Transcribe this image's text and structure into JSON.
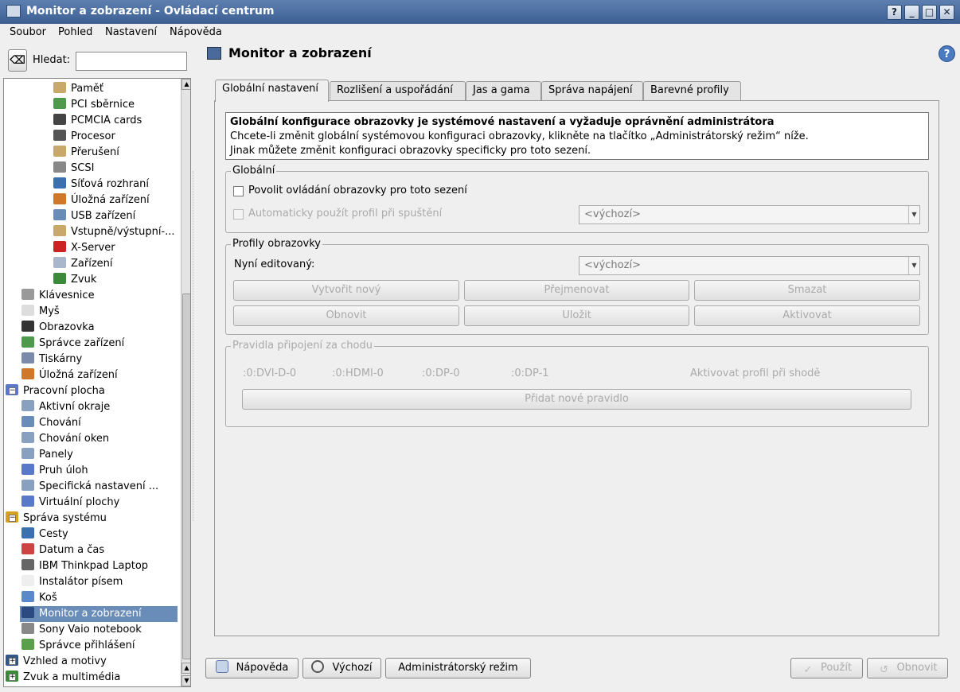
{
  "window": {
    "title": "Monitor a zobrazení - Ovládací centrum",
    "buttons": [
      "?",
      "_",
      "□",
      "✕"
    ]
  },
  "menubar": {
    "items": [
      "Soubor",
      "Pohled",
      "Nastavení",
      "Nápověda"
    ]
  },
  "search": {
    "label": "Hledat:",
    "value": ""
  },
  "tree": [
    {
      "label": "Paměť",
      "icon": "memory-icon"
    },
    {
      "label": "PCI sběrnice",
      "icon": "pci-icon"
    },
    {
      "label": "PCMCIA cards",
      "icon": "pcmcia-icon"
    },
    {
      "label": "Procesor",
      "icon": "cpu-icon"
    },
    {
      "label": "Přerušení",
      "icon": "interrupt-icon"
    },
    {
      "label": "SCSI",
      "icon": "scsi-icon"
    },
    {
      "label": "Síťová rozhraní",
      "icon": "network-icon"
    },
    {
      "label": "Úložná zařízení",
      "icon": "storage-icon"
    },
    {
      "label": "USB zařízení",
      "icon": "usb-icon"
    },
    {
      "label": "Vstupně/výstupní-...",
      "icon": "io-icon"
    },
    {
      "label": "X-Server",
      "icon": "xserver-icon"
    },
    {
      "label": "Zařízení",
      "icon": "devices-icon"
    },
    {
      "label": "Zvuk",
      "icon": "sound-icon"
    },
    {
      "label": "Klávesnice",
      "icon": "keyboard-icon"
    },
    {
      "label": "Myš",
      "icon": "mouse-icon"
    },
    {
      "label": "Obrazovka",
      "icon": "screen-icon"
    },
    {
      "label": "Správce zařízení",
      "icon": "device-manager-icon"
    },
    {
      "label": "Tiskárny",
      "icon": "printer-icon"
    },
    {
      "label": "Úložná zařízení",
      "icon": "storage-icon"
    },
    {
      "label": "Pracovní plocha",
      "icon": "desktop-icon"
    },
    {
      "label": "Aktivní okraje",
      "icon": "borders-icon"
    },
    {
      "label": "Chování",
      "icon": "behavior-icon"
    },
    {
      "label": "Chování oken",
      "icon": "window-behavior-icon"
    },
    {
      "label": "Panely",
      "icon": "panels-icon"
    },
    {
      "label": "Pruh úloh",
      "icon": "taskbar-icon"
    },
    {
      "label": "Specifická nastavení ...",
      "icon": "specific-settings-icon"
    },
    {
      "label": "Virtuální plochy",
      "icon": "virtual-desktops-icon"
    },
    {
      "label": "Správa systému",
      "icon": "system-admin-icon"
    },
    {
      "label": "Cesty",
      "icon": "paths-icon"
    },
    {
      "label": "Datum a čas",
      "icon": "calendar-icon"
    },
    {
      "label": "IBM Thinkpad Laptop",
      "icon": "laptop-icon"
    },
    {
      "label": "Instalátor písem",
      "icon": "font-installer-icon"
    },
    {
      "label": "Koš",
      "icon": "trash-icon"
    },
    {
      "label": "Monitor a zobrazení",
      "icon": "monitor-icon"
    },
    {
      "label": "Sony Vaio notebook",
      "icon": "laptop-icon"
    },
    {
      "label": "Správce přihlášení",
      "icon": "login-manager-icon"
    },
    {
      "label": "Vzhled a motivy",
      "icon": "appearance-icon"
    },
    {
      "label": "Zvuk a multimédia",
      "icon": "multimedia-icon"
    }
  ],
  "page": {
    "title": "Monitor a zobrazení"
  },
  "tabs": [
    "Globální nastavení",
    "Rozlišení a uspořádání",
    "Jas a gama",
    "Správa napájení",
    "Barevné profily"
  ],
  "info": {
    "bold": "Globální konfigurace obrazovky je systémové nastavení a vyžaduje oprávnění administrátora",
    "line1": "Chcete-li změnit globální systémovou konfiguraci obrazovky, klikněte na tlačítko „Administrátorský režim“ níže.",
    "line2": "Jinak můžete změnit konfiguraci obrazovky specificky pro toto sezení."
  },
  "global": {
    "title": "Globální",
    "check1": "Povolit ovládání obrazovky pro toto sezení",
    "check2": "Automaticky použít profil při spuštění",
    "combo": "<výchozí>"
  },
  "profiles": {
    "title": "Profily obrazovky",
    "editing_label": "Nyní editovaný:",
    "combo": "<výchozí>",
    "buttons": [
      "Vytvořit nový",
      "Přejmenovat",
      "Smazat",
      "Obnovit",
      "Uložit",
      "Aktivovat"
    ]
  },
  "rules": {
    "title": "Pravidla připojení za chodu",
    "outputs": [
      ":0:DVI-D-0",
      ":0:HDMI-0",
      ":0:DP-0",
      ":0:DP-1"
    ],
    "activate_label": "Aktivovat profil při shodě",
    "add_button": "Přidat nové pravidlo"
  },
  "bottom": {
    "help": "Nápověda",
    "default": "Výchozí",
    "admin": "Administrátorský režim",
    "apply": "Použít",
    "reset": "Obnovit"
  }
}
